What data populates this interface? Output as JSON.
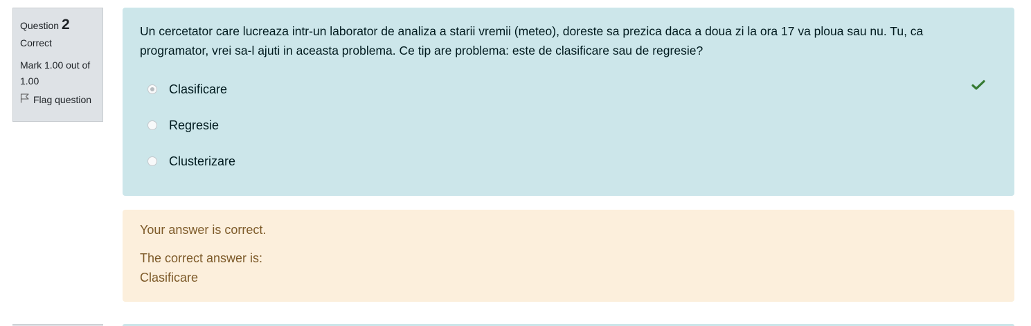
{
  "question_info": {
    "question_label": "Question",
    "question_number": "2",
    "state": "Correct",
    "grade": "Mark 1.00 out of 1.00",
    "flag_label": "Flag question"
  },
  "formulation": {
    "question_text": "Un cercetator care lucreaza intr-un laborator de analiza a starii vremii (meteo), doreste sa prezica daca a doua zi la ora 17 va ploua sau nu. Tu, ca programator, vrei sa-l ajuti in aceasta problema. Ce tip are problema: este de clasificare sau de regresie?",
    "options": [
      {
        "label": "Clasificare",
        "selected": true,
        "correct": true
      },
      {
        "label": "Regresie",
        "selected": false
      },
      {
        "label": "Clusterizare",
        "selected": false
      }
    ],
    "check_icon": "check-icon"
  },
  "feedback": {
    "general": "Your answer is correct.",
    "right_answer_intro": "The correct answer is:",
    "right_answer": "Clasificare"
  },
  "colors": {
    "formulation_bg": "#cce6ea",
    "feedback_bg": "#fcefdc",
    "info_bg": "#dee2e6",
    "check_green": "#357a32"
  }
}
